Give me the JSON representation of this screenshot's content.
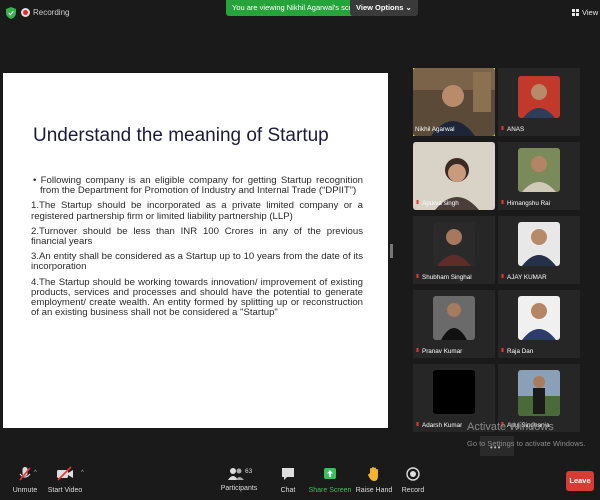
{
  "topbar": {
    "recording_label": "Recording",
    "banner_text": "You are viewing Nikhil Agarwal's screen",
    "view_options_label": "View Options ⌄",
    "view_label": "View"
  },
  "slide": {
    "title": "Understand the meaning of Startup",
    "items": [
      "• Following company is an eligible company for getting Startup recognition from the Department for Promotion of Industry and Internal Trade (“DPIIT”)",
      "1.The Startup should be incorporated as a private limited company or a registered partnership firm or limited liability partnership (LLP)",
      "2.Turnover should be less than INR 100 Crores in any of the previous financial years",
      "3.An entity shall be considered as a Startup up to 10 years from the date of its incorporation",
      "4.The Startup should be working towards innovation/ improvement of existing products, services and processes and should have the potential to generate employment/ create wealth. An entity formed by splitting up or reconstruction of an existing business shall not be considered a \"Startup\""
    ]
  },
  "participants": [
    {
      "name": "Nikhil Agarwal",
      "active": true
    },
    {
      "name": "ANAS"
    },
    {
      "name": "Apurva singh"
    },
    {
      "name": "Himangshu Rai"
    },
    {
      "name": "Shubham Singhal"
    },
    {
      "name": "AJAY KUMAR"
    },
    {
      "name": "Pranav Kumar"
    },
    {
      "name": "Raja Dan"
    },
    {
      "name": "Adarsh Kumar"
    },
    {
      "name": "Anuj Singhania"
    }
  ],
  "watermark": {
    "line1": "Activate Windows",
    "line2": "Go to Settings to activate Windows."
  },
  "toolbar": {
    "unmute_label": "Unmute",
    "start_video_label": "Start Video",
    "participants_label": "Participants",
    "participants_count": "63",
    "chat_label": "Chat",
    "share_screen_label": "Share Screen",
    "raise_hand_label": "Raise Hand",
    "record_label": "Record",
    "leave_label": "Leave"
  },
  "colors": {
    "banner": "#27a33c",
    "leave": "#d73b33",
    "share_screen": "#36c25a",
    "active_speaker": "#c7d23a"
  }
}
